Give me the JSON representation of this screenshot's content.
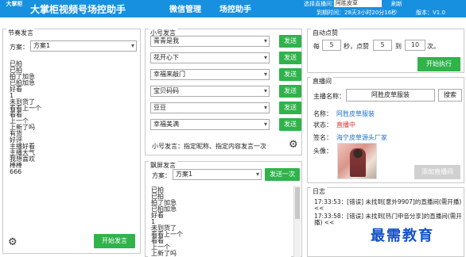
{
  "app": {
    "logo_text": "大掌柜",
    "title": "大掌柜视频号场控助手",
    "nav": [
      "微信管理",
      "场控助手"
    ],
    "room_label": "选择直播间：",
    "room_value": "阿胜皮草",
    "refresh_label": "刷新",
    "expire_text": "到期时间：28天3小时20分16秒",
    "version_text": "版本：V1.0"
  },
  "festival": {
    "title": "节奏发言",
    "scheme_label": "方案：",
    "scheme_value": "方案1",
    "text_lines": [
      "已拍",
      "已拍",
      "拍了加急",
      "已拍加急",
      "好看",
      "1",
      "未到货了",
      "看看上一个",
      "看看",
      "上一个",
      "上新了吗",
      "有货",
      "好评",
      "主播好看",
      "主播大气",
      "我想喜欢",
      "棒棒",
      "666"
    ],
    "start_button": "开始发言"
  },
  "small_account": {
    "title": "小号发言",
    "rows": [
      {
        "name": "青青是我",
        "send": "发送"
      },
      {
        "name": "花开心下",
        "send": "发送"
      },
      {
        "name": "幸福来敲门",
        "send": "发送"
      },
      {
        "name": "宝贝码码",
        "send": "发送"
      },
      {
        "name": "豆豆",
        "send": "发送"
      },
      {
        "name": "幸福美满",
        "send": "发送"
      }
    ],
    "hint": "小号发言：指定昵称、指定内容发言一次"
  },
  "screen": {
    "title": "飘屏发言",
    "scheme_label": "方案：",
    "scheme_value": "方案1",
    "send_once": "发送一次",
    "text_lines": [
      "已拍",
      "已拍",
      "拍了加急",
      "已拍加急",
      "好看",
      "1",
      "未到货了",
      "看看上一个",
      "看看",
      "上一个",
      "上新了吗"
    ]
  },
  "auto_like": {
    "title": "自动点赞",
    "every_label": "每",
    "every_value": "5",
    "seconds_label": "秒，点赞",
    "min_value": "5",
    "to_label": "到",
    "max_value": "10",
    "times_label": "次。",
    "start_button": "开始执行"
  },
  "live_room": {
    "title": "直播间",
    "anchor_label": "主播名称：",
    "anchor_value": "阿胜皮草服装",
    "search_button": "搜索",
    "name_label": "名称：",
    "name_value": "阿胜皮草服装",
    "status_label": "状态：",
    "status_value": "直播中",
    "sign_label": "签名：",
    "sign_value": "海宁皮草源头厂家",
    "avatar_label": "头像：",
    "add_button": "添加直播间"
  },
  "log": {
    "title": "日志",
    "lines": [
      "17:33:53：[错误] 未找到[意外9907]的直播间(需开播) <<",
      "17:33:58：[错误] 未找到[热门申音分享]的直播间(需开播) <<"
    ]
  },
  "watermark": "最需教育",
  "colors": {
    "primary": "#1890e0",
    "green": "#2fb34a",
    "link": "#1a6fd1",
    "live": "#e03030"
  }
}
